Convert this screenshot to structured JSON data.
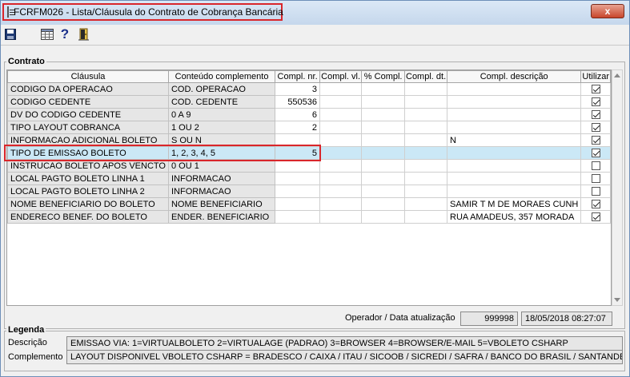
{
  "window": {
    "title": "FCRFM026 - Lista/Cláusula do Contrato de Cobrança Bancária",
    "close_label": "x"
  },
  "toolbar": {
    "icons": [
      "save-icon",
      "grid-icon",
      "help-icon",
      "exit-door-icon"
    ],
    "help_glyph": "?"
  },
  "contrato": {
    "label": "Contrato",
    "columns": [
      "Cláusula",
      "Conteúdo complemento",
      "Compl. nr.",
      "Compl. vl.",
      "% Compl.",
      "Compl. dt.",
      "Compl. descrição",
      "Utilizar"
    ],
    "rows": [
      {
        "clausula": "CODIGO DA OPERACAO",
        "conteudo": "COD. OPERACAO",
        "nr": "3",
        "vl": "",
        "pct": "",
        "dt": "",
        "descricao": "",
        "utilizar": true
      },
      {
        "clausula": "CODIGO CEDENTE",
        "conteudo": "COD. CEDENTE",
        "nr": "550536",
        "vl": "",
        "pct": "",
        "dt": "",
        "descricao": "",
        "utilizar": true
      },
      {
        "clausula": "DV DO CODIGO CEDENTE",
        "conteudo": "0 A 9",
        "nr": "6",
        "vl": "",
        "pct": "",
        "dt": "",
        "descricao": "",
        "utilizar": true
      },
      {
        "clausula": "TIPO LAYOUT COBRANCA",
        "conteudo": "1 OU 2",
        "nr": "2",
        "vl": "",
        "pct": "",
        "dt": "",
        "descricao": "",
        "utilizar": true
      },
      {
        "clausula": "INFORMACAO ADICIONAL BOLETO",
        "conteudo": "S OU N",
        "nr": "",
        "vl": "",
        "pct": "",
        "dt": "",
        "descricao": "N",
        "utilizar": true
      },
      {
        "clausula": "TIPO DE EMISSAO BOLETO",
        "conteudo": "1, 2,  3, 4, 5",
        "nr": "5",
        "vl": "",
        "pct": "",
        "dt": "",
        "descricao": "",
        "utilizar": true
      },
      {
        "clausula": "INSTRUCAO BOLETO APOS VENCTO",
        "conteudo": "0 OU 1",
        "nr": "",
        "vl": "",
        "pct": "",
        "dt": "",
        "descricao": "",
        "utilizar": false
      },
      {
        "clausula": "LOCAL PAGTO BOLETO LINHA 1",
        "conteudo": "INFORMACAO",
        "nr": "",
        "vl": "",
        "pct": "",
        "dt": "",
        "descricao": "",
        "utilizar": false
      },
      {
        "clausula": "LOCAL PAGTO BOLETO LINHA 2",
        "conteudo": "INFORMACAO",
        "nr": "",
        "vl": "",
        "pct": "",
        "dt": "",
        "descricao": "",
        "utilizar": false
      },
      {
        "clausula": "NOME BENEFICIARIO DO BOLETO",
        "conteudo": "NOME BENEFICIARIO",
        "nr": "",
        "vl": "",
        "pct": "",
        "dt": "",
        "descricao": "SAMIR T M DE MORAES CUNH",
        "utilizar": true
      },
      {
        "clausula": "ENDERECO BENEF. DO BOLETO",
        "conteudo": "ENDER. BENEFICIARIO",
        "nr": "",
        "vl": "",
        "pct": "",
        "dt": "",
        "descricao": "RUA AMADEUS, 357 MORADA",
        "utilizar": true
      }
    ],
    "selected_row": 5,
    "operador_label": "Operador / Data atualização",
    "operador_value": "999998",
    "data_value": "18/05/2018 08:27:07"
  },
  "legenda": {
    "label": "Legenda",
    "descricao_label": "Descrição",
    "descricao_value": "EMISSAO VIA: 1=VIRTUALBOLETO 2=VIRTUALAGE (PADRAO) 3=BROWSER 4=BROWSER/E-MAIL  5=VBOLETO CSHARP",
    "complemento_label": "Complemento",
    "complemento_value": "LAYOUT DISPONIVEL VBOLETO CSHARP = BRADESCO / CAIXA / ITAU / SICOOB / SICREDI / SAFRA / BANCO DO BRASIL / SANTANDER"
  },
  "colors": {
    "highlight": "#d9262b",
    "selection": "#cbe8f6"
  }
}
